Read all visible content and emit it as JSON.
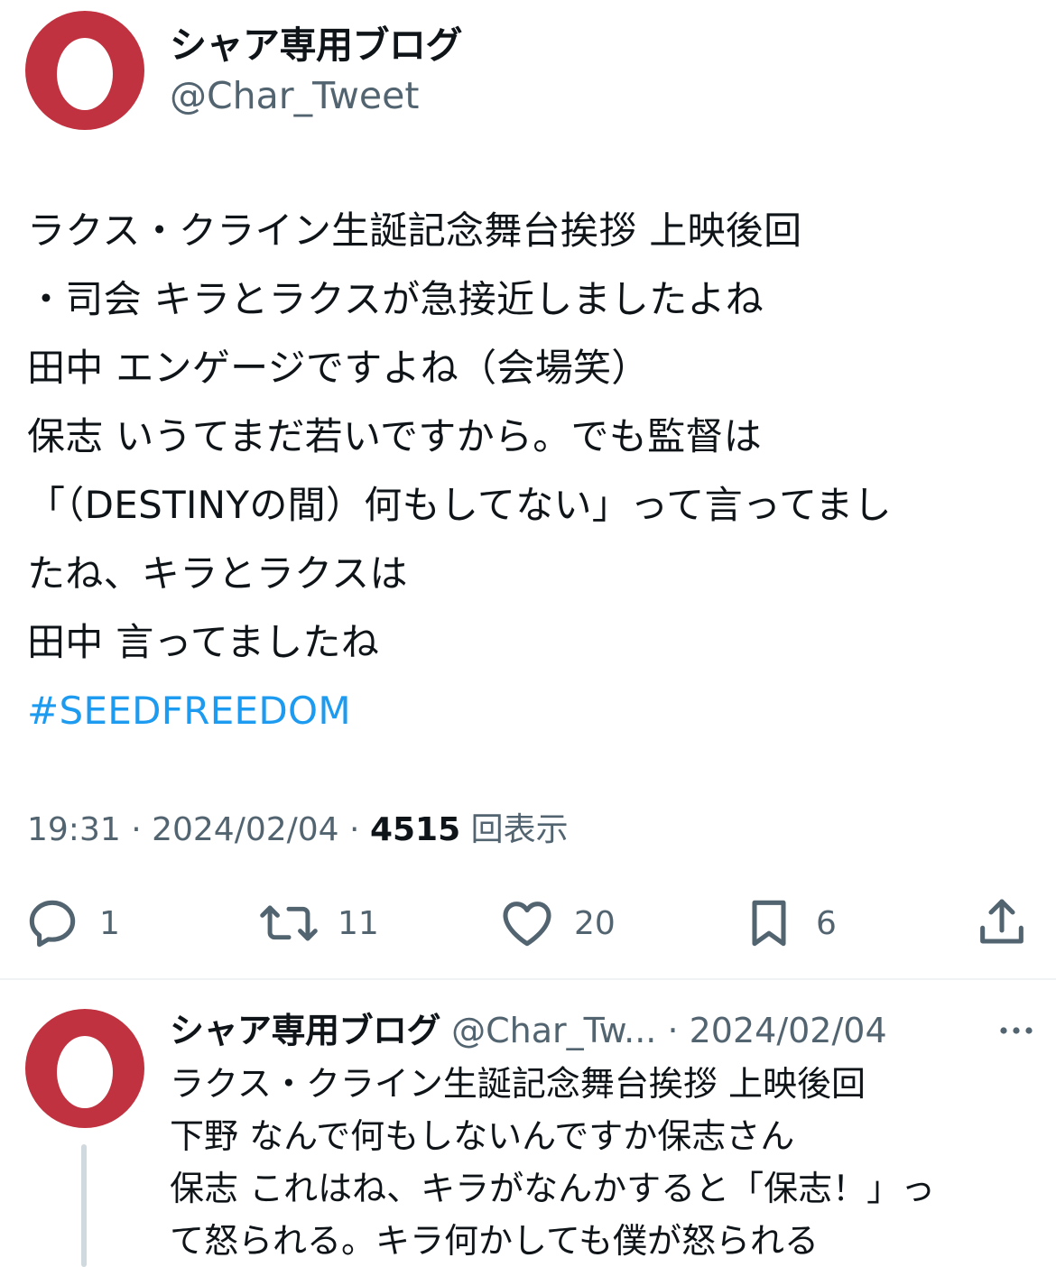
{
  "tweet": {
    "author": {
      "display_name": "シャア専用ブログ",
      "handle": "@Char_Tweet",
      "avatar_colors": {
        "ring": "#c0323f",
        "egg": "#ffffff"
      }
    },
    "lines": [
      "ラクス・クライン生誕記念舞台挨拶 上映後回",
      "・司会 キラとラクスが急接近しましたよね",
      "田中 エンゲージですよね（会場笑）",
      "保志 いうてまだ若いですから。でも監督は",
      "「（DESTINYの間）何もしてない」って言ってまし",
      "たね、キラとラクスは",
      "田中 言ってましたね"
    ],
    "hashtag": "#SEEDFREEDOM",
    "meta": {
      "time": "19:31",
      "sep1": " · ",
      "date": "2024/02/04",
      "sep2": " · ",
      "views_count": "4515",
      "views_label": " 回表示"
    },
    "actions": {
      "reply": {
        "icon": "reply-icon",
        "count": "1"
      },
      "retweet": {
        "icon": "retweet-icon",
        "count": "11"
      },
      "like": {
        "icon": "heart-icon",
        "count": "20"
      },
      "bookmark": {
        "icon": "bookmark-icon",
        "count": "6"
      },
      "share": {
        "icon": "share-icon"
      }
    }
  },
  "reply": {
    "display_name": "シャア専用ブログ",
    "handle": " @Char_Tw...",
    "sep": " · ",
    "date": "2024/02/04",
    "lines": [
      "ラクス・クライン生誕記念舞台挨拶 上映後回",
      "下野 なんで何もしないんですか保志さん",
      "保志 これはね、キラがなんかすると「保志！」っ",
      "て怒られる。キラ何かしても僕が怒られる"
    ]
  },
  "colors": {
    "text": "#0f1419",
    "secondary": "#536471",
    "link": "#1d9bf0",
    "divider": "#eff3f4",
    "thread": "#cfd9de"
  }
}
